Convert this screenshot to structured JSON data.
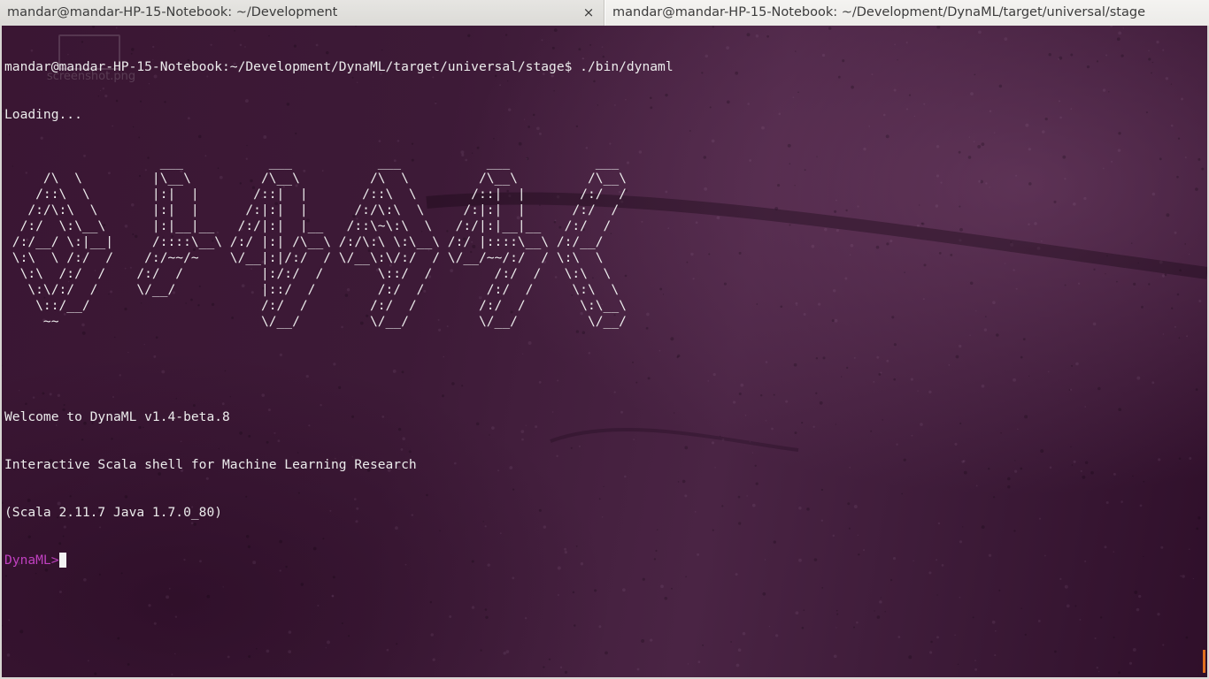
{
  "tabs": [
    {
      "title": "mandar@mandar-HP-15-Notebook: ~/Development",
      "close_icon": "×",
      "active": false
    },
    {
      "title": "mandar@mandar-HP-15-Notebook: ~/Development/DynaML/target/universal/stage",
      "close_icon": "",
      "active": true
    }
  ],
  "desktop": {
    "ghost_icon_label": "screenshot.png"
  },
  "terminal": {
    "command_line": "mandar@mandar-HP-15-Notebook:~/Development/DynaML/target/universal/stage$ ./bin/dynaml",
    "loading": "Loading...",
    "ascii_banner": [
      "                    ___           ___           ___           ___           ___     ",
      "     /\\  \\         |\\__\\         /\\__\\         /\\  \\         /\\__\\         /\\__\\    ",
      "    /::\\  \\        |:|  |       /::|  |       /::\\  \\       /::|  |       /:/  /    ",
      "   /:/\\:\\  \\       |:|  |      /:|:|  |      /:/\\:\\  \\     /:|:|  |      /:/  /     ",
      "  /:/  \\:\\__\\      |:|__|__   /:/|:|  |__   /::\\~\\:\\  \\   /:/|:|__|__   /:/  /      ",
      " /:/__/ \\:|__|     /::::\\__\\ /:/ |:| /\\__\\ /:/\\:\\ \\:\\__\\ /:/ |::::\\__\\ /:/__/       ",
      " \\:\\  \\ /:/  /    /:/~~/~    \\/__|:|/:/  / \\/__\\:\\/:/  / \\/__/~~/:/  / \\:\\  \\       ",
      "  \\:\\  /:/  /    /:/  /          |:/:/  /       \\::/  /        /:/  /   \\:\\  \\      ",
      "   \\:\\/:/  /     \\/__/           |::/  /        /:/  /        /:/  /     \\:\\  \\     ",
      "    \\::/__/                      /:/  /        /:/  /        /:/  /       \\:\\__\\    ",
      "     ~~                          \\/__/         \\/__/         \\/__/         \\/__/    "
    ],
    "welcome": "Welcome to DynaML v1.4-beta.8",
    "subtitle": "Interactive Scala shell for Machine Learning Research",
    "versions": "(Scala 2.11.7 Java 1.7.0_80)",
    "prompt": "DynaML>"
  },
  "colors": {
    "terminal_text": "#ececec",
    "prompt": "#c040c0",
    "background": "#3d1a37",
    "tabbar": "#e8e7e4"
  }
}
